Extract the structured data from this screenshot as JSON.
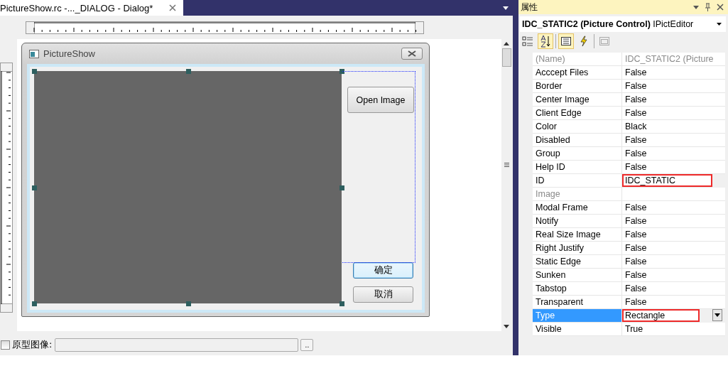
{
  "document_tab": {
    "title": "PictureShow.rc -..._DIALOG - Dialog*",
    "selected": true
  },
  "dialog": {
    "title": "PictureShow",
    "buttons": [
      {
        "label": "Open Image",
        "default": false
      },
      {
        "label": "确定",
        "default": true
      },
      {
        "label": "取消",
        "default": false
      }
    ]
  },
  "bottom_bar": {
    "checkbox": {
      "label": "原型图像:",
      "checked": false
    },
    "browse_button": ".."
  },
  "properties": {
    "title": "属性",
    "object_name": "IDC_STATIC2 (Picture Control)",
    "object_type": "IPictEditor",
    "toolbar": [
      {
        "kind": "categorized",
        "selected": false
      },
      {
        "kind": "alphabetical",
        "selected": true
      },
      {
        "kind": "properties",
        "selected": true
      },
      {
        "kind": "events",
        "selected": false
      },
      {
        "kind": "pages",
        "selected": false
      }
    ],
    "rows": [
      {
        "name": "(Name)",
        "value": "IDC_STATIC2 (Picture",
        "disabled": true,
        "selected": false,
        "highlighted": false
      },
      {
        "name": "Acccept Files",
        "value": "False",
        "disabled": false,
        "selected": false,
        "highlighted": false
      },
      {
        "name": "Border",
        "value": "False",
        "disabled": false,
        "selected": false,
        "highlighted": false
      },
      {
        "name": "Center Image",
        "value": "False",
        "disabled": false,
        "selected": false,
        "highlighted": false
      },
      {
        "name": "Client Edge",
        "value": "False",
        "disabled": false,
        "selected": false,
        "highlighted": false
      },
      {
        "name": "Color",
        "value": "Black",
        "disabled": false,
        "selected": false,
        "highlighted": false
      },
      {
        "name": "Disabled",
        "value": "False",
        "disabled": false,
        "selected": false,
        "highlighted": false
      },
      {
        "name": "Group",
        "value": "False",
        "disabled": false,
        "selected": false,
        "highlighted": false
      },
      {
        "name": "Help ID",
        "value": "False",
        "disabled": false,
        "selected": false,
        "highlighted": false
      },
      {
        "name": "ID",
        "value": "IDC_STATIC",
        "disabled": false,
        "selected": false,
        "highlighted": true
      },
      {
        "name": "Image",
        "disabled": true,
        "selected": false,
        "highlighted": false
      },
      {
        "name": "Modal Frame",
        "value": "False",
        "disabled": false,
        "selected": false,
        "highlighted": false
      },
      {
        "name": "Notify",
        "value": "False",
        "disabled": false,
        "selected": false,
        "highlighted": false
      },
      {
        "name": "Real Size Image",
        "value": "False",
        "disabled": false,
        "selected": false,
        "highlighted": false
      },
      {
        "name": "Right Justify",
        "value": "False",
        "disabled": false,
        "selected": false,
        "highlighted": false
      },
      {
        "name": "Static Edge",
        "value": "False",
        "disabled": false,
        "selected": false,
        "highlighted": false
      },
      {
        "name": "Sunken",
        "value": "False",
        "disabled": false,
        "selected": false,
        "highlighted": false
      },
      {
        "name": "Tabstop",
        "value": "False",
        "disabled": false,
        "selected": false,
        "highlighted": false
      },
      {
        "name": "Transparent",
        "value": "False",
        "disabled": false,
        "selected": false,
        "highlighted": false
      },
      {
        "name": "Type",
        "value": "Rectangle",
        "disabled": false,
        "selected": true,
        "highlighted": true
      },
      {
        "name": "Visible",
        "value": "True",
        "disabled": false,
        "selected": false,
        "highlighted": false
      }
    ]
  }
}
